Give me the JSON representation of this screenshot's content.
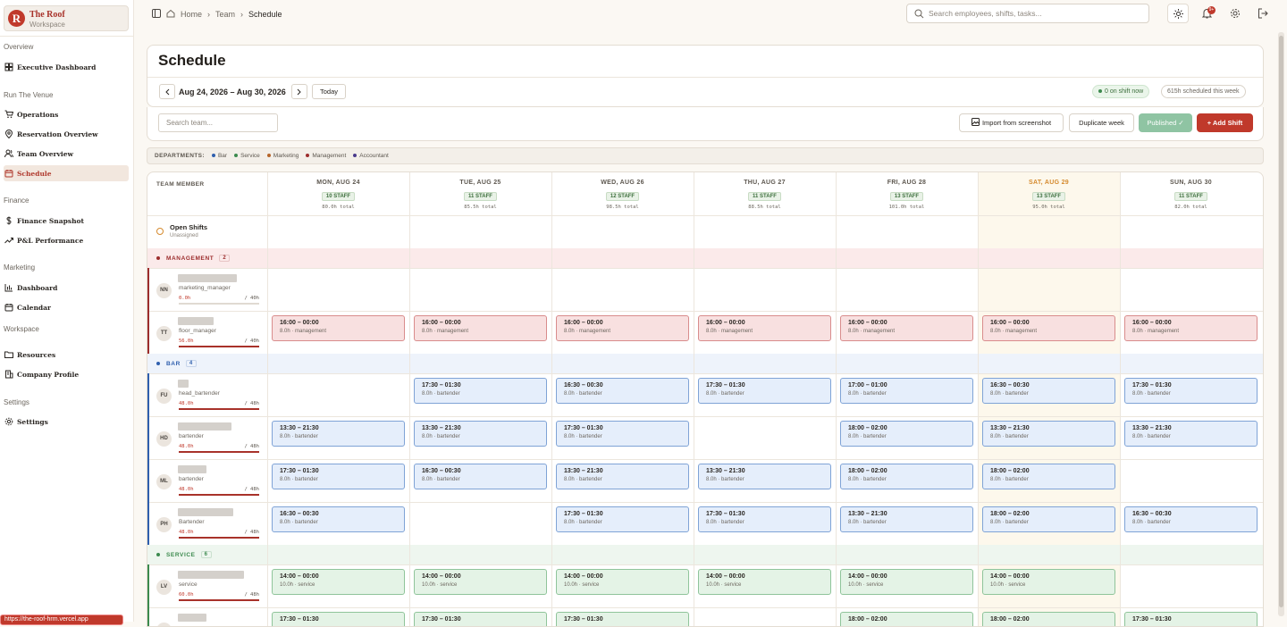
{
  "brand": {
    "name": "The Roof",
    "sub": "Workspace",
    "logo": "R"
  },
  "sidebar": {
    "sections": [
      {
        "label": "Overview",
        "items": [
          {
            "label": "Executive Dashboard",
            "icon": "dashboard-icon"
          }
        ]
      },
      {
        "label": "Run The Venue",
        "items": [
          {
            "label": "Operations",
            "icon": "cart-icon"
          },
          {
            "label": "Reservation Overview",
            "icon": "pin-icon"
          },
          {
            "label": "Team Overview",
            "icon": "users-icon"
          },
          {
            "label": "Schedule",
            "icon": "calendar-icon",
            "active": true
          }
        ]
      },
      {
        "label": "Finance",
        "items": [
          {
            "label": "Finance Snapshot",
            "icon": "dollar-icon"
          },
          {
            "label": "P&L Performance",
            "icon": "trend-icon"
          }
        ]
      },
      {
        "label": "Marketing",
        "items": [
          {
            "label": "Dashboard",
            "icon": "bar-chart-icon"
          },
          {
            "label": "Calendar",
            "icon": "calendar-icon"
          }
        ]
      },
      {
        "label": "Workspace",
        "items": [
          {
            "label": "Resources",
            "icon": "folder-icon"
          },
          {
            "label": "Company Profile",
            "icon": "building-icon"
          }
        ]
      },
      {
        "label": "Settings",
        "items": [
          {
            "label": "Settings",
            "icon": "gear-icon"
          }
        ]
      }
    ],
    "toast": "https://the-roof-hrm.vercel.app"
  },
  "topbar": {
    "crumbs": [
      "Home",
      "Team",
      "Schedule"
    ],
    "search_placeholder": "Search employees, shifts, tasks...",
    "notif_count": "9+"
  },
  "page": {
    "title": "Schedule",
    "daterange": "Aug 24, 2026 – Aug 30, 2026",
    "today": "Today",
    "on_shift": "0 on shift now",
    "scheduled": "615h scheduled this week"
  },
  "toolbar": {
    "search_placeholder": "Search team...",
    "import": "Import from screenshot",
    "duplicate": "Duplicate week",
    "published": "Published ✓",
    "add": "+ Add Shift"
  },
  "departments": {
    "label": "DEPARTMENTS:",
    "items": [
      {
        "name": "Bar",
        "color": "#2f5fae"
      },
      {
        "name": "Service",
        "color": "#3c8a4e"
      },
      {
        "name": "Marketing",
        "color": "#b5652a"
      },
      {
        "name": "Management",
        "color": "#9c2d2d"
      },
      {
        "name": "Accountant",
        "color": "#4a3b8c"
      }
    ]
  },
  "grid": {
    "team_member": "TEAM MEMBER",
    "days": [
      {
        "label": "MON, AUG 24",
        "staff": "10 STAFF",
        "total": "80.0h total"
      },
      {
        "label": "TUE, AUG 25",
        "staff": "11 STAFF",
        "total": "85.5h total"
      },
      {
        "label": "WED, AUG 26",
        "staff": "12 STAFF",
        "total": "98.5h total"
      },
      {
        "label": "THU, AUG 27",
        "staff": "11 STAFF",
        "total": "88.5h total"
      },
      {
        "label": "FRI, AUG 28",
        "staff": "13 STAFF",
        "total": "101.0h total"
      },
      {
        "label": "SAT, AUG 29",
        "staff": "13 STAFF",
        "total": "95.0h total",
        "highlight": true
      },
      {
        "label": "SUN, AUG 30",
        "staff": "11 STAFF",
        "total": "82.0h total"
      }
    ],
    "open": {
      "title": "Open Shifts",
      "sub": "Unassigned"
    },
    "groups": [
      {
        "name": "MANAGEMENT",
        "count": "2",
        "kind": "mg",
        "color": "#9c2d2d",
        "bg": "#fbeaea",
        "rows": [
          {
            "initials": "NN",
            "role": "marketing_manager",
            "hours": "0.0h",
            "max": "/ 40h",
            "fill": 0,
            "shifts": [
              null,
              null,
              null,
              null,
              null,
              null,
              null
            ]
          },
          {
            "initials": "TT",
            "role": "floor_manager",
            "hours": "56.0h",
            "max": "/ 40h",
            "fill": 1,
            "shifts": [
              [
                "16:00 – 00:00",
                "8.0h · management"
              ],
              [
                "16:00 – 00:00",
                "8.0h · management"
              ],
              [
                "16:00 – 00:00",
                "8.0h · management"
              ],
              [
                "16:00 – 00:00",
                "8.0h · management"
              ],
              [
                "16:00 – 00:00",
                "8.0h · management"
              ],
              [
                "16:00 – 00:00",
                "8.0h · management"
              ],
              [
                "16:00 – 00:00",
                "8.0h · management"
              ]
            ]
          }
        ]
      },
      {
        "name": "BAR",
        "count": "4",
        "kind": "bar",
        "color": "#2f5fae",
        "bg": "#eef3fb",
        "rows": [
          {
            "initials": "FU",
            "role": "head_bartender",
            "hours": "48.0h",
            "max": "/ 48h",
            "fill": 1,
            "shifts": [
              null,
              [
                "17:30 – 01:30",
                "8.0h · bartender"
              ],
              [
                "16:30 – 00:30",
                "8.0h · bartender"
              ],
              [
                "17:30 – 01:30",
                "8.0h · bartender"
              ],
              [
                "17:00 – 01:00",
                "8.0h · bartender"
              ],
              [
                "16:30 – 00:30",
                "8.0h · bartender"
              ],
              [
                "17:30 – 01:30",
                "8.0h · bartender"
              ]
            ]
          },
          {
            "initials": "HD",
            "role": "bartender",
            "hours": "48.0h",
            "max": "/ 48h",
            "fill": 1,
            "shifts": [
              [
                "13:30 – 21:30",
                "8.0h · bartender"
              ],
              [
                "13:30 – 21:30",
                "8.0h · bartender"
              ],
              [
                "17:30 – 01:30",
                "8.0h · bartender"
              ],
              null,
              [
                "18:00 – 02:00",
                "8.0h · bartender"
              ],
              [
                "13:30 – 21:30",
                "8.0h · bartender"
              ],
              [
                "13:30 – 21:30",
                "8.0h · bartender"
              ]
            ]
          },
          {
            "initials": "ML",
            "role": "bartender",
            "hours": "48.0h",
            "max": "/ 48h",
            "fill": 1,
            "shifts": [
              [
                "17:30 – 01:30",
                "8.0h · bartender"
              ],
              [
                "16:30 – 00:30",
                "8.0h · bartender"
              ],
              [
                "13:30 – 21:30",
                "8.0h · bartender"
              ],
              [
                "13:30 – 21:30",
                "8.0h · bartender"
              ],
              [
                "18:00 – 02:00",
                "8.0h · bartender"
              ],
              [
                "18:00 – 02:00",
                "8.0h · bartender"
              ],
              null
            ]
          },
          {
            "initials": "PH",
            "role": "Bartender",
            "hours": "48.0h",
            "max": "/ 48h",
            "fill": 1,
            "shifts": [
              [
                "16:30 – 00:30",
                "8.0h · bartender"
              ],
              null,
              [
                "17:30 – 01:30",
                "8.0h · bartender"
              ],
              [
                "17:30 – 01:30",
                "8.0h · bartender"
              ],
              [
                "13:30 – 21:30",
                "8.0h · bartender"
              ],
              [
                "18:00 – 02:00",
                "8.0h · bartender"
              ],
              [
                "16:30 – 00:30",
                "8.0h · bartender"
              ]
            ]
          }
        ]
      },
      {
        "name": "SERVICE",
        "count": "6",
        "kind": "sv",
        "color": "#3c8a4e",
        "bg": "#eef6ef",
        "rows": [
          {
            "initials": "LV",
            "role": "service",
            "hours": "60.0h",
            "max": "/ 48h",
            "fill": 1,
            "shifts": [
              [
                "14:00 – 00:00",
                "10.0h · service"
              ],
              [
                "14:00 – 00:00",
                "10.0h · service"
              ],
              [
                "14:00 – 00:00",
                "10.0h · service"
              ],
              [
                "14:00 – 00:00",
                "10.0h · service"
              ],
              [
                "14:00 – 00:00",
                "10.0h · service"
              ],
              [
                "14:00 – 00:00",
                "10.0h · service"
              ],
              null
            ]
          },
          {
            "initials": "",
            "role": "",
            "hours": "",
            "max": "",
            "fill": 0,
            "shifts": [
              [
                "17:30 – 01:30",
                ""
              ],
              [
                "17:30 – 01:30",
                ""
              ],
              [
                "17:30 – 01:30",
                ""
              ],
              null,
              [
                "18:00 – 02:00",
                ""
              ],
              [
                "18:00 – 02:00",
                ""
              ],
              [
                "17:30 – 01:30",
                ""
              ]
            ]
          }
        ]
      }
    ]
  }
}
